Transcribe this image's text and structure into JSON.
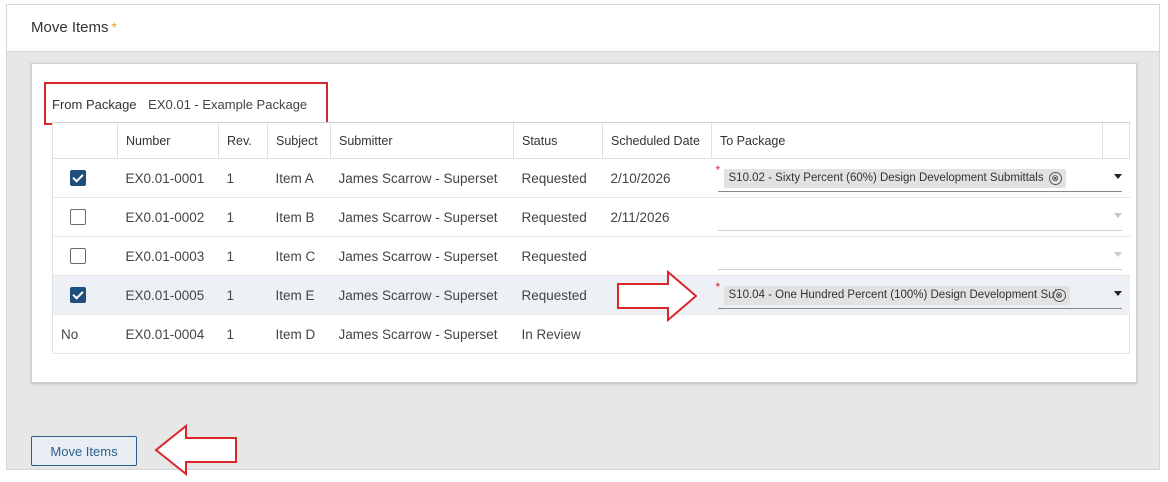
{
  "header": {
    "title": "Move Items",
    "required_mark": "*"
  },
  "from_package": {
    "label": "From Package",
    "value": "EX0.01 - Example Package"
  },
  "table": {
    "columns": [
      "",
      "Number",
      "Rev.",
      "Subject",
      "Submitter",
      "Status",
      "Scheduled Date",
      "To Package"
    ],
    "rows": [
      {
        "select": "checked",
        "number": "EX0.01-0001",
        "rev": "1",
        "subject": "Item A",
        "submitter": "James Scarrow - Superset",
        "status": "Requested",
        "scheduled": "2/10/2026",
        "to_package": "S10.02 - Sixty Percent (60%) Design Development Submittals"
      },
      {
        "select": "unchecked",
        "number": "EX0.01-0002",
        "rev": "1",
        "subject": "Item B",
        "submitter": "James Scarrow - Superset",
        "status": "Requested",
        "scheduled": "2/11/2026",
        "to_package": ""
      },
      {
        "select": "unchecked",
        "number": "EX0.01-0003",
        "rev": "1",
        "subject": "Item C",
        "submitter": "James Scarrow - Superset",
        "status": "Requested",
        "scheduled": "",
        "to_package": ""
      },
      {
        "select": "checked",
        "number": "EX0.01-0005",
        "rev": "1",
        "subject": "Item E",
        "submitter": "James Scarrow - Superset",
        "status": "Requested",
        "scheduled": "",
        "to_package": "S10.04 - One Hundred Percent (100%) Design Development Sul"
      },
      {
        "select": "No",
        "number": "EX0.01-0004",
        "rev": "1",
        "subject": "Item D",
        "submitter": "James Scarrow - Superset",
        "status": "In Review",
        "scheduled": "",
        "to_package": ""
      }
    ],
    "required_mark": "*",
    "chip_clear_symbol": "⊗"
  },
  "footer": {
    "move_button": "Move Items"
  },
  "colors": {
    "accent": "#1f4e7d",
    "highlight": "#d9262a",
    "required": "#f0a030",
    "row_highlight": "#edf1f6"
  },
  "icons": [
    "checkbox-checked-icon",
    "checkbox-icon",
    "clear-chip-icon",
    "dropdown-caret-icon",
    "right-arrow-icon",
    "left-arrow-icon"
  ]
}
